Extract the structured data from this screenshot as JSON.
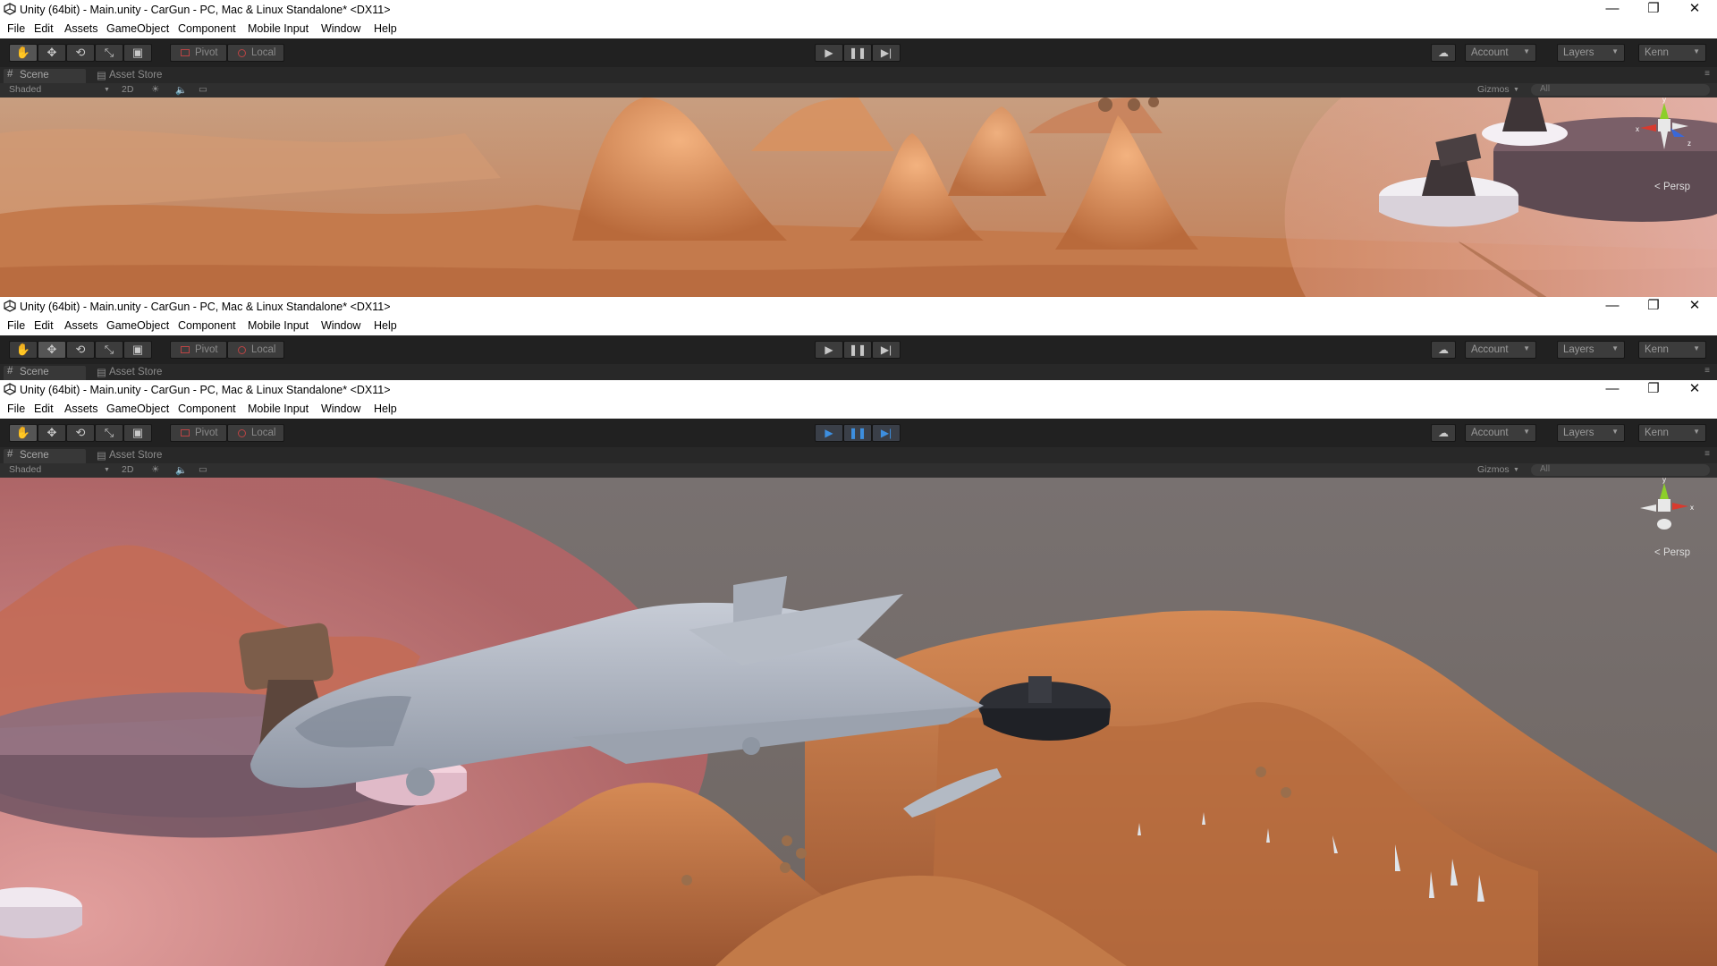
{
  "app": {
    "title": "Unity (64bit) - Main.unity - CarGun - PC, Mac & Linux Standalone* <DX11>",
    "controls": {
      "minimize": "—",
      "restore": "❐",
      "close": "✕"
    }
  },
  "menu": [
    "File",
    "Edit",
    "Assets",
    "GameObject",
    "Component",
    "Mobile Input",
    "Window",
    "Help"
  ],
  "toolbar": {
    "pivot": "Pivot",
    "local": "Local",
    "account": "Account",
    "layers": "Layers",
    "layout": "Kenn",
    "tools": [
      "hand-tool",
      "move-tool",
      "rotate-tool",
      "scale-tool",
      "rect-tool"
    ],
    "play_active_color": "#3d8fe0"
  },
  "tabs": {
    "scene": "Scene",
    "asset_store": "Asset Store"
  },
  "scene_toolbar": {
    "shading": "Shaded",
    "mode_2d": "2D",
    "gizmos": "Gizmos",
    "search_placeholder": "All"
  },
  "viewport": {
    "projection": "Persp",
    "axis_x": "x",
    "axis_y": "y",
    "axis_z": "z"
  }
}
